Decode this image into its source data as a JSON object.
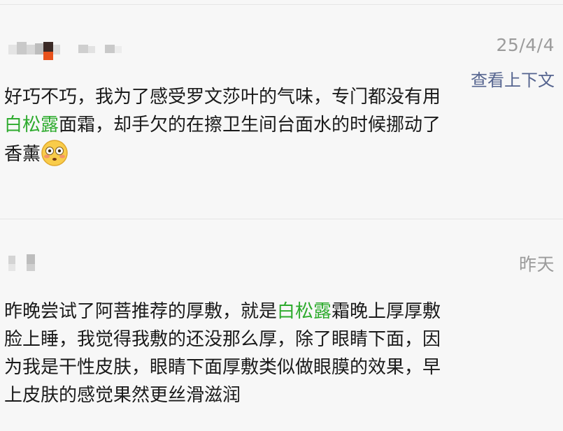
{
  "comments": [
    {
      "date": "25/4/4",
      "context_link": "查看上下文",
      "body_before": "好巧不巧，我为了感受罗文莎叶的气味，专门都没有用",
      "highlight": "白松露",
      "body_after": "面霜，却手欠的在擦卫生间台面水的时候挪动了香薰",
      "emoji": "flushed-face-emoji"
    },
    {
      "date": "昨天",
      "body_before": "昨晚尝试了阿菩推荐的厚敷，就是",
      "highlight": "白松露",
      "body_after": "霜晚上厚厚敷脸上睡，我觉得我敷的还没那么厚，除了眼睛下面，因为我是干性皮肤，眼睛下面厚敷类似做眼膜的效果，早上皮肤的感觉果然更丝滑滋润"
    }
  ],
  "colors": {
    "highlight": "#2eab2e",
    "link": "#55648f",
    "date": "#9b9b9b",
    "text": "#1a1a1a",
    "background": "#f7f7f7"
  }
}
